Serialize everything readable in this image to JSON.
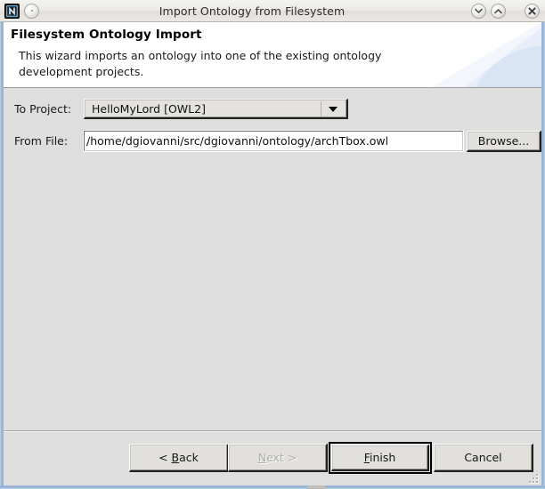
{
  "window": {
    "title": "Import Ontology from Filesystem",
    "app_icon": "neon-app-icon",
    "controls": {
      "menu": "window-menu-button",
      "minimize": "minimize-button",
      "maximize": "maximize-button",
      "close": "close-button"
    }
  },
  "header": {
    "title": "Filesystem Ontology Import",
    "description": "This wizard imports an ontology into one of the existing ontology development projects."
  },
  "form": {
    "project": {
      "label": "To Project:",
      "value": "HelloMyLord [OWL2]",
      "options": [
        "HelloMyLord [OWL2]"
      ]
    },
    "file": {
      "label": "From File:",
      "value": "/home/dgiovanni/src/dgiovanni/ontology/archTbox.owl",
      "placeholder": ""
    },
    "browse_label": "Browse..."
  },
  "buttons": {
    "back": {
      "prefix": "< ",
      "mnemonic": "B",
      "rest": "ack",
      "enabled": true
    },
    "next": {
      "prefix": "",
      "mnemonic": "N",
      "rest": "ext >",
      "enabled": false
    },
    "finish": {
      "prefix": "",
      "mnemonic": "F",
      "rest": "inish",
      "enabled": true,
      "is_default": true
    },
    "cancel": {
      "label": "Cancel",
      "enabled": true
    }
  },
  "colors": {
    "window_frame": "#93b2d4",
    "dialog_background": "#dedede",
    "header_background": "#ffffff",
    "swoosh_accent": "#ccd9ee",
    "text": "#1a1a1a",
    "disabled_text": "#b0aeab"
  }
}
